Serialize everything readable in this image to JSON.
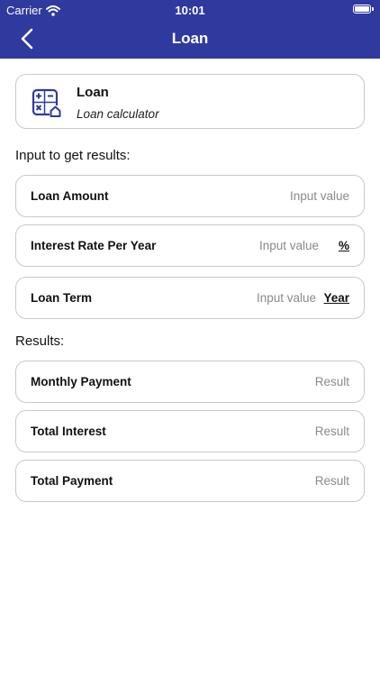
{
  "status_bar": {
    "carrier": "Carrier",
    "time": "10:01"
  },
  "navbar": {
    "title": "Loan"
  },
  "header_card": {
    "title": "Loan",
    "subtitle": "Loan calculator",
    "icon": "calculator-icon"
  },
  "inputs": {
    "section_label": "Input to get results:",
    "loan_amount": {
      "label": "Loan Amount",
      "placeholder": "Input value"
    },
    "interest_rate": {
      "label": "Interest Rate Per Year",
      "placeholder": "Input value",
      "unit": "%"
    },
    "loan_term": {
      "label": "Loan Term",
      "placeholder": "Input value",
      "unit": "Year"
    }
  },
  "results": {
    "section_label": "Results:",
    "monthly_payment": {
      "label": "Monthly Payment",
      "value": "Result"
    },
    "total_interest": {
      "label": "Total Interest",
      "value": "Result"
    },
    "total_payment": {
      "label": "Total Payment",
      "value": "Result"
    }
  },
  "colors": {
    "accent": "#2f3a9f",
    "border": "#c9c9c9",
    "placeholder": "#8a8a8a"
  }
}
